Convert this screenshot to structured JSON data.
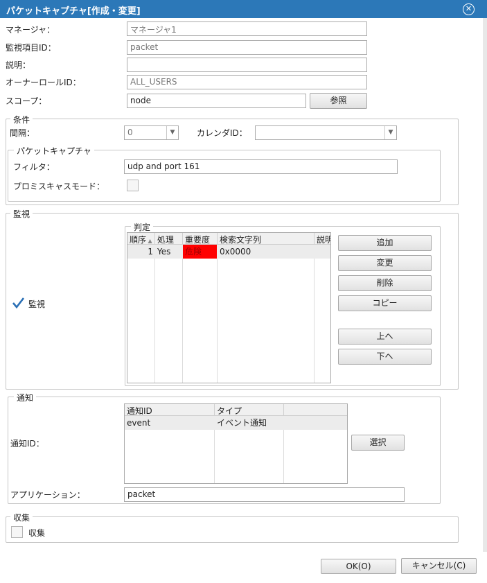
{
  "window": {
    "title": "パケットキャプチャ[作成・変更]"
  },
  "form": {
    "manager_label": "マネージャ：",
    "manager_value": "マネージャ1",
    "monitor_id_label": "監視項目ID：",
    "monitor_id_value": "packet",
    "description_label": "説明：",
    "description_value": "",
    "owner_role_label": "オーナーロールID：",
    "owner_role_value": "ALL_USERS",
    "scope_label": "スコープ：",
    "scope_value": "node",
    "scope_ref_button": "参照"
  },
  "conditions": {
    "legend": "条件",
    "interval_label": "間隔：",
    "interval_value": "0",
    "calendar_label": "カレンダID：",
    "calendar_value": ""
  },
  "packet": {
    "legend": "パケットキャプチャ",
    "filter_label": "フィルタ：",
    "filter_value": "udp and port 161",
    "promisc_label": "プロミスキャスモード：",
    "promisc_checked": false
  },
  "monitor": {
    "legend": "監視",
    "enabled_label": "監視",
    "enabled": true,
    "judge_legend": "判定",
    "columns": [
      "順序",
      "処理",
      "重要度",
      "検索文字列",
      "説明"
    ],
    "rows": [
      {
        "order": "1",
        "process": "Yes",
        "priority": "危険",
        "pattern": "0x0000",
        "description": ""
      }
    ],
    "priority_color": "#ff0000",
    "buttons": {
      "add": "追加",
      "modify": "変更",
      "delete": "削除",
      "copy": "コピー",
      "up": "上へ",
      "down": "下へ"
    }
  },
  "notify": {
    "legend": "通知",
    "notify_id_label": "通知ID：",
    "columns": [
      "通知ID",
      "タイプ"
    ],
    "rows": [
      {
        "id": "event",
        "type": "イベント通知"
      }
    ],
    "select_button": "選択",
    "application_label": "アプリケーション：",
    "application_value": "packet"
  },
  "collect": {
    "legend": "収集",
    "enabled_label": "収集",
    "enabled": false
  },
  "footer": {
    "ok_button": "OK(O)",
    "cancel_button": "キャンセル(C)"
  },
  "colors": {
    "title_bar": "#2c78b8",
    "check": "#2a6fb5"
  }
}
